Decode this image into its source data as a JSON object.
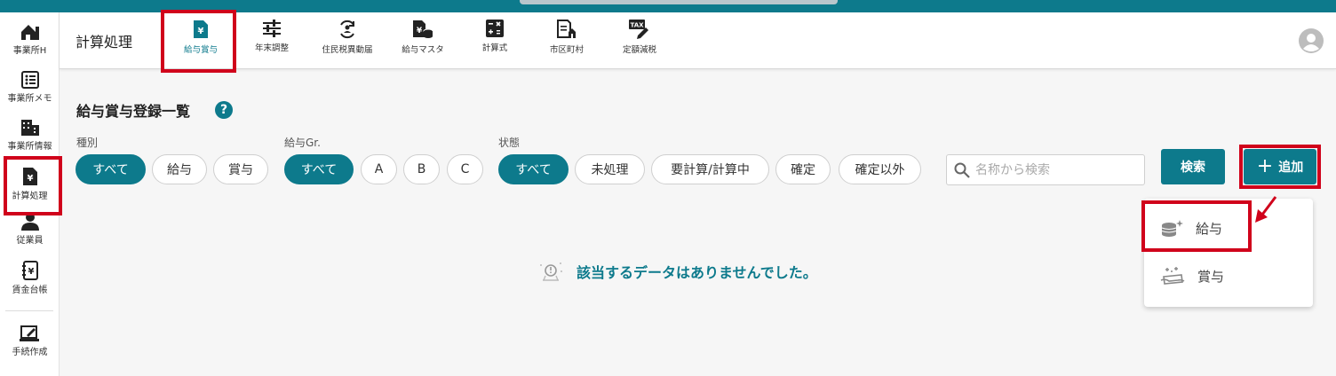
{
  "app": {
    "module_title": "計算処理"
  },
  "sidebar": {
    "items": [
      {
        "label": "事業所H",
        "icon": "office-home-icon"
      },
      {
        "label": "事業所メモ",
        "icon": "memo-list-icon"
      },
      {
        "label": "事業所情報",
        "icon": "building-icon"
      },
      {
        "label": "計算処理",
        "icon": "yen-document-icon",
        "active": true
      },
      {
        "label": "従業員",
        "icon": "person-icon"
      },
      {
        "label": "賃金台帳",
        "icon": "ledger-icon"
      },
      {
        "label": "手続作成",
        "icon": "procedure-edit-icon"
      }
    ]
  },
  "header": {
    "tabs": [
      {
        "label": "給与賞与",
        "icon": "yen-document-icon",
        "active": true
      },
      {
        "label": "年末調整",
        "icon": "sliders-icon"
      },
      {
        "label": "住民税異動届",
        "icon": "transfer-person-icon"
      },
      {
        "label": "給与マスタ",
        "icon": "yen-database-icon"
      },
      {
        "label": "計算式",
        "icon": "calculator-icon"
      },
      {
        "label": "市区町村",
        "icon": "city-document-icon"
      },
      {
        "label": "定額減税",
        "icon": "tax-edit-icon"
      }
    ]
  },
  "main": {
    "title": "給与賞与登録一覧",
    "help": "?",
    "filters": {
      "type": {
        "label": "種別",
        "options": [
          "すべて",
          "給与",
          "賞与"
        ],
        "selected": "すべて"
      },
      "group": {
        "label": "給与Gr.",
        "options": [
          "すべて",
          "A",
          "B",
          "C"
        ],
        "selected": "すべて"
      },
      "status": {
        "label": "状態",
        "options": [
          "すべて",
          "未処理",
          "要計算/計算中",
          "確定",
          "確定以外"
        ],
        "selected": "すべて"
      }
    },
    "search": {
      "placeholder": "名称から検索",
      "value": ""
    },
    "search_button": "検索",
    "add_button": "追加",
    "add_menu": [
      {
        "label": "給与",
        "icon": "coins-icon"
      },
      {
        "label": "賞与",
        "icon": "bonus-icon"
      }
    ],
    "empty_message": "該当するデータはありませんでした。"
  },
  "colors": {
    "accent": "#0d7a8c",
    "highlight": "#d0021b",
    "background": "#f6f6f6"
  }
}
